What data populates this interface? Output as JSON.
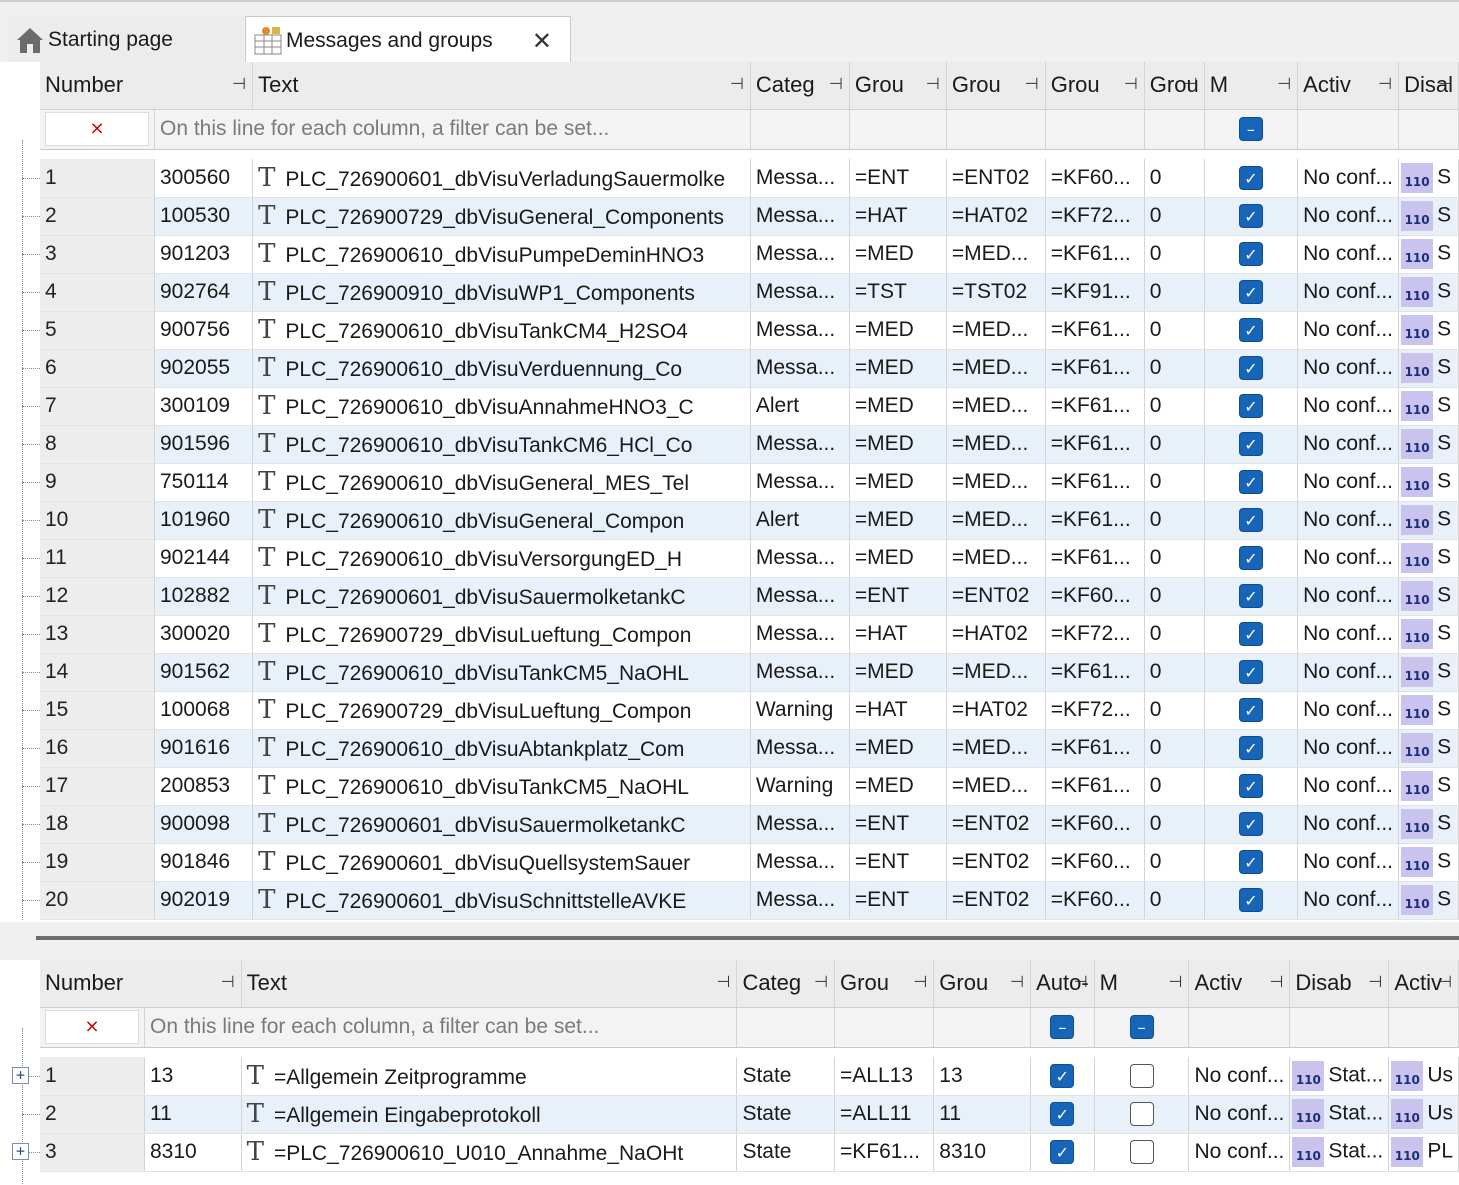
{
  "tabs": [
    {
      "label": "Starting page",
      "icon": "home-icon"
    },
    {
      "label": "Messages and groups",
      "icon": "messages-groups-icon",
      "close": "✕"
    }
  ],
  "filter_placeholder": "On this line for each column, a filter can be set...",
  "grid1": {
    "headers": [
      "Number",
      "Text",
      "Categ",
      "Grou",
      "Grou",
      "Grou",
      "Grou",
      "M",
      "Activ",
      "Disal"
    ],
    "rows": [
      {
        "n": "1",
        "num": "300560",
        "text": "PLC_726900601_dbVisuVerladungSauermolke",
        "cat": "Messa...",
        "g1": "=ENT",
        "g2": "=ENT02",
        "g3": "=KF60...",
        "g4": "0",
        "act": "No conf...",
        "dis": "S"
      },
      {
        "n": "2",
        "num": "100530",
        "text": "PLC_726900729_dbVisuGeneral_Components",
        "cat": "Messa...",
        "g1": "=HAT",
        "g2": "=HAT02",
        "g3": "=KF72...",
        "g4": "0",
        "act": "No conf...",
        "dis": "S"
      },
      {
        "n": "3",
        "num": "901203",
        "text": "PLC_726900610_dbVisuPumpeDeminHNO3",
        "cat": "Messa...",
        "g1": "=MED",
        "g2": "=MED...",
        "g3": "=KF61...",
        "g4": "0",
        "act": "No conf...",
        "dis": "S"
      },
      {
        "n": "4",
        "num": "902764",
        "text": "PLC_726900910_dbVisuWP1_Components",
        "cat": "Messa...",
        "g1": "=TST",
        "g2": "=TST02",
        "g3": "=KF91...",
        "g4": "0",
        "act": "No conf...",
        "dis": "S"
      },
      {
        "n": "5",
        "num": "900756",
        "text": "PLC_726900610_dbVisuTankCM4_H2SO4",
        "cat": "Messa...",
        "g1": "=MED",
        "g2": "=MED...",
        "g3": "=KF61...",
        "g4": "0",
        "act": "No conf...",
        "dis": "S"
      },
      {
        "n": "6",
        "num": "902055",
        "text": "PLC_726900610_dbVisuVerduennung_Co",
        "cat": "Messa...",
        "g1": "=MED",
        "g2": "=MED...",
        "g3": "=KF61...",
        "g4": "0",
        "act": "No conf...",
        "dis": "S"
      },
      {
        "n": "7",
        "num": "300109",
        "text": "PLC_726900610_dbVisuAnnahmeHNO3_C",
        "cat": "Alert",
        "g1": "=MED",
        "g2": "=MED...",
        "g3": "=KF61...",
        "g4": "0",
        "act": "No conf...",
        "dis": "S"
      },
      {
        "n": "8",
        "num": "901596",
        "text": "PLC_726900610_dbVisuTankCM6_HCl_Co",
        "cat": "Messa...",
        "g1": "=MED",
        "g2": "=MED...",
        "g3": "=KF61...",
        "g4": "0",
        "act": "No conf...",
        "dis": "S"
      },
      {
        "n": "9",
        "num": "750114",
        "text": "PLC_726900610_dbVisuGeneral_MES_Tel",
        "cat": "Messa...",
        "g1": "=MED",
        "g2": "=MED...",
        "g3": "=KF61...",
        "g4": "0",
        "act": "No conf...",
        "dis": "S"
      },
      {
        "n": "10",
        "num": "101960",
        "text": "PLC_726900610_dbVisuGeneral_Compon",
        "cat": "Alert",
        "g1": "=MED",
        "g2": "=MED...",
        "g3": "=KF61...",
        "g4": "0",
        "act": "No conf...",
        "dis": "S"
      },
      {
        "n": "11",
        "num": "902144",
        "text": "PLC_726900610_dbVisuVersorgungED_H",
        "cat": "Messa...",
        "g1": "=MED",
        "g2": "=MED...",
        "g3": "=KF61...",
        "g4": "0",
        "act": "No conf...",
        "dis": "S"
      },
      {
        "n": "12",
        "num": "102882",
        "text": "PLC_726900601_dbVisuSauermolketankC",
        "cat": "Messa...",
        "g1": "=ENT",
        "g2": "=ENT02",
        "g3": "=KF60...",
        "g4": "0",
        "act": "No conf...",
        "dis": "S"
      },
      {
        "n": "13",
        "num": "300020",
        "text": "PLC_726900729_dbVisuLueftung_Compon",
        "cat": "Messa...",
        "g1": "=HAT",
        "g2": "=HAT02",
        "g3": "=KF72...",
        "g4": "0",
        "act": "No conf...",
        "dis": "S"
      },
      {
        "n": "14",
        "num": "901562",
        "text": "PLC_726900610_dbVisuTankCM5_NaOHL",
        "cat": "Messa...",
        "g1": "=MED",
        "g2": "=MED...",
        "g3": "=KF61...",
        "g4": "0",
        "act": "No conf...",
        "dis": "S"
      },
      {
        "n": "15",
        "num": "100068",
        "text": "PLC_726900729_dbVisuLueftung_Compon",
        "cat": "Warning",
        "g1": "=HAT",
        "g2": "=HAT02",
        "g3": "=KF72...",
        "g4": "0",
        "act": "No conf...",
        "dis": "S"
      },
      {
        "n": "16",
        "num": "901616",
        "text": "PLC_726900610_dbVisuAbtankplatz_Com",
        "cat": "Messa...",
        "g1": "=MED",
        "g2": "=MED...",
        "g3": "=KF61...",
        "g4": "0",
        "act": "No conf...",
        "dis": "S"
      },
      {
        "n": "17",
        "num": "200853",
        "text": "PLC_726900610_dbVisuTankCM5_NaOHL",
        "cat": "Warning",
        "g1": "=MED",
        "g2": "=MED...",
        "g3": "=KF61...",
        "g4": "0",
        "act": "No conf...",
        "dis": "S"
      },
      {
        "n": "18",
        "num": "900098",
        "text": "PLC_726900601_dbVisuSauermolketankC",
        "cat": "Messa...",
        "g1": "=ENT",
        "g2": "=ENT02",
        "g3": "=KF60...",
        "g4": "0",
        "act": "No conf...",
        "dis": "S"
      },
      {
        "n": "19",
        "num": "901846",
        "text": "PLC_726900601_dbVisuQuellsystemSauer",
        "cat": "Messa...",
        "g1": "=ENT",
        "g2": "=ENT02",
        "g3": "=KF60...",
        "g4": "0",
        "act": "No conf...",
        "dis": "S"
      },
      {
        "n": "20",
        "num": "902019",
        "text": "PLC_726900601_dbVisuSchnittstelleAVKE",
        "cat": "Messa...",
        "g1": "=ENT",
        "g2": "=ENT02",
        "g3": "=KF60...",
        "g4": "0",
        "act": "No conf...",
        "dis": "S"
      }
    ]
  },
  "grid2": {
    "headers": [
      "Number",
      "Text",
      "Categ",
      "Grou",
      "Grou",
      "Auto-",
      "M",
      "Activ",
      "Disab",
      "Activ"
    ],
    "rows": [
      {
        "n": "1",
        "num": "13",
        "text": "=Allgemein Zeitprogramme",
        "cat": "State",
        "g1": "=ALL13",
        "g2": "13",
        "auto": true,
        "m": false,
        "act": "No conf...",
        "dis": "Stat...",
        "act2": "Us",
        "expand": true
      },
      {
        "n": "2",
        "num": "11",
        "text": "=Allgemein Eingabeprotokoll",
        "cat": "State",
        "g1": "=ALL11",
        "g2": "11",
        "auto": true,
        "m": false,
        "act": "No conf...",
        "dis": "Stat...",
        "act2": "Us",
        "expand": false
      },
      {
        "n": "3",
        "num": "8310",
        "text": "=PLC_726900610_U010_Annahme_NaOHt",
        "cat": "State",
        "g1": "=KF61...",
        "g2": "8310",
        "auto": true,
        "m": false,
        "act": "No conf...",
        "dis": "Stat...",
        "act2": "PL",
        "expand": true
      }
    ]
  },
  "badge_text": "110",
  "colors": {
    "accent": "#1765b8",
    "row_alt": "#e8f0fa",
    "badge_bg": "#c9c3ee"
  }
}
